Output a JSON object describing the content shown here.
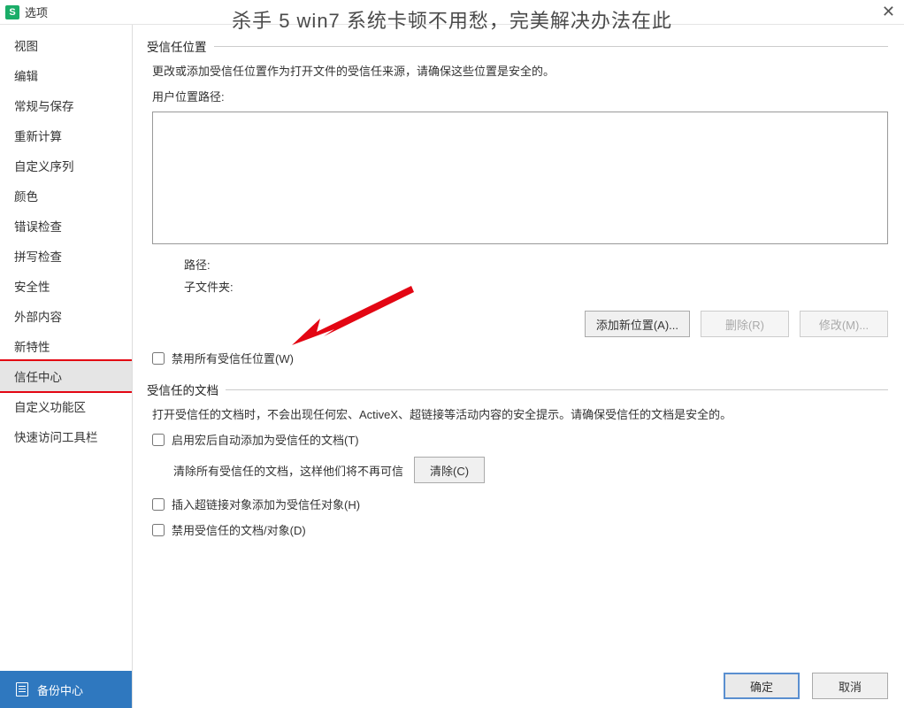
{
  "titlebar": {
    "title": "选项"
  },
  "overlay": "杀手 5 win7 系统卡顿不用愁，完美解决办法在此",
  "sidebar": {
    "items": [
      {
        "label": "视图"
      },
      {
        "label": "编辑"
      },
      {
        "label": "常规与保存"
      },
      {
        "label": "重新计算"
      },
      {
        "label": "自定义序列"
      },
      {
        "label": "颜色"
      },
      {
        "label": "错误检查"
      },
      {
        "label": "拼写检查"
      },
      {
        "label": "安全性"
      },
      {
        "label": "外部内容"
      },
      {
        "label": "新特性"
      },
      {
        "label": "信任中心",
        "selected": true
      },
      {
        "label": "自定义功能区"
      },
      {
        "label": "快速访问工具栏"
      }
    ],
    "footer": "备份中心"
  },
  "trust_location": {
    "header": "受信任位置",
    "desc": "更改或添加受信任位置作为打开文件的受信任来源，请确保这些位置是安全的。",
    "user_path_label": "用户位置路径:",
    "path_label": "路径:",
    "subfolder_label": "子文件夹:",
    "textarea_value": "",
    "add_btn": "添加新位置(A)...",
    "delete_btn": "删除(R)",
    "modify_btn": "修改(M)...",
    "disable_all_label": "禁用所有受信任位置(W)"
  },
  "trust_doc": {
    "header": "受信任的文档",
    "desc": "打开受信任的文档时，不会出现任何宏、ActiveX、超链接等活动内容的安全提示。请确保受信任的文档是安全的。",
    "macro_label": "启用宏后自动添加为受信任的文档(T)",
    "clear_desc": "清除所有受信任的文档，这样他们将不再可信",
    "clear_btn": "清除(C)",
    "hyperlink_label": "插入超链接对象添加为受信任对象(H)",
    "disable_doc_label": "禁用受信任的文档/对象(D)"
  },
  "footer": {
    "ok": "确定",
    "cancel": "取消"
  }
}
